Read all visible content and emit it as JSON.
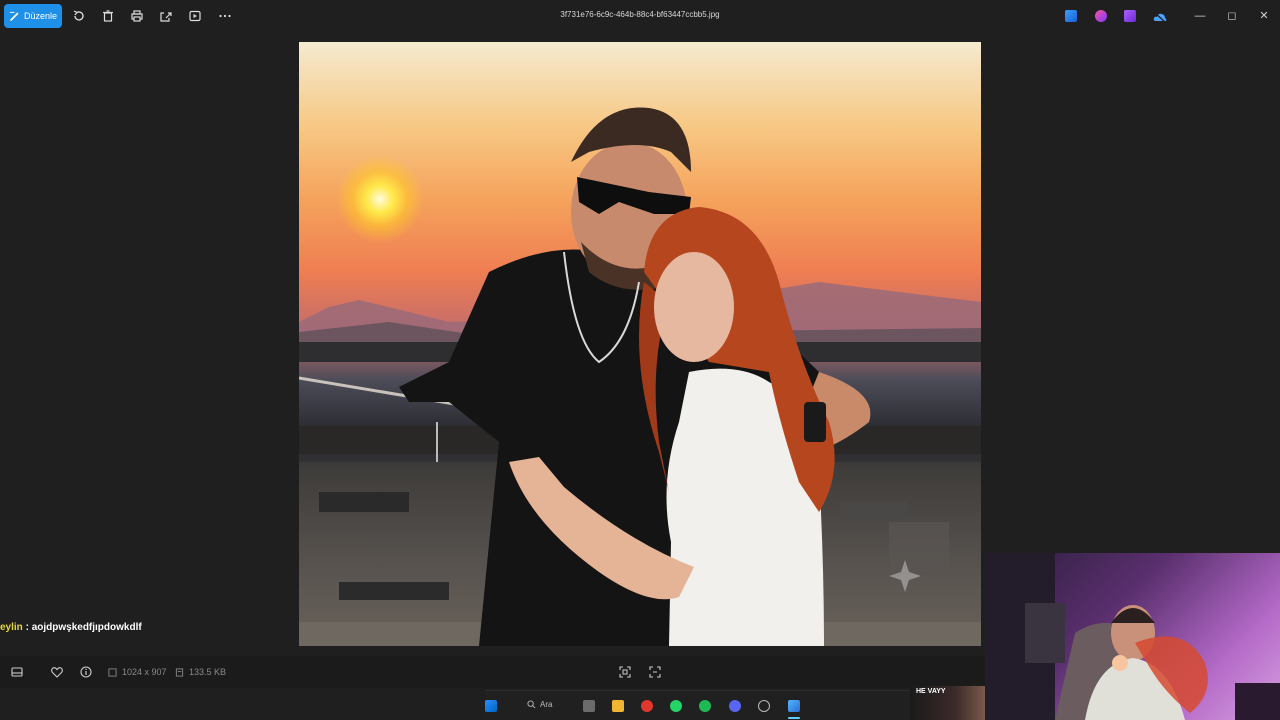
{
  "toolbar": {
    "edit_label": "Düzenle",
    "icons": [
      "rotate-icon",
      "delete-icon",
      "print-icon",
      "share-icon",
      "slideshow-icon",
      "more-icon"
    ]
  },
  "window": {
    "filename": "3f731e76-6c9c-464b-88c4-bf63447ccbb5.jpg",
    "controls": {
      "minimize": "—",
      "maximize": "◻",
      "close": "✕"
    }
  },
  "chat": {
    "user": "eylin",
    "separator": " : ",
    "message": "aojdpwşkedfjıpdowkdlf"
  },
  "statusbar": {
    "dimensions": "1024 x 907",
    "file_size": "133.5 KB"
  },
  "taskbar": {
    "search_label": "Ara"
  },
  "stream": {
    "overlay_text": "HE VAYY"
  },
  "colors": {
    "accent": "#1e90e8",
    "background": "#1f1f1f",
    "chat_user": "#e8d44a"
  }
}
